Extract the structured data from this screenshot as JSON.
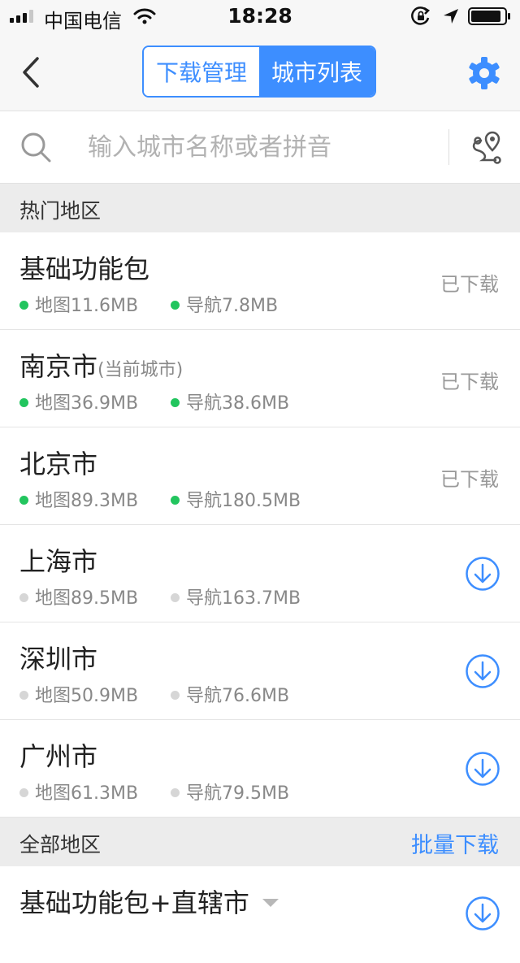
{
  "status_bar": {
    "carrier": "中国电信",
    "time": "18:28"
  },
  "nav": {
    "tab_download": "下载管理",
    "tab_cities": "城市列表"
  },
  "search": {
    "placeholder": "输入城市名称或者拼音",
    "value": ""
  },
  "sections": {
    "hot": "热门地区",
    "all": "全部地区",
    "batch_download": "批量下载"
  },
  "hot_items": [
    {
      "name": "基础功能包",
      "note": "",
      "map": "地图11.6MB",
      "nav": "导航7.8MB",
      "status": "已下载"
    },
    {
      "name": "南京市",
      "note": "(当前城市)",
      "map": "地图36.9MB",
      "nav": "导航38.6MB",
      "status": "已下载"
    },
    {
      "name": "北京市",
      "note": "",
      "map": "地图89.3MB",
      "nav": "导航180.5MB",
      "status": "已下载"
    },
    {
      "name": "上海市",
      "note": "",
      "map": "地图89.5MB",
      "nav": "导航163.7MB",
      "status": ""
    },
    {
      "name": "深圳市",
      "note": "",
      "map": "地图50.9MB",
      "nav": "导航76.6MB",
      "status": ""
    },
    {
      "name": "广州市",
      "note": "",
      "map": "地图61.3MB",
      "nav": "导航79.5MB",
      "status": ""
    }
  ],
  "all_items": [
    {
      "name": "基础功能包+直辖市"
    }
  ],
  "colors": {
    "accent": "#3d8eff",
    "downloaded_dot": "#22c55e",
    "pending_dot": "#d6d6d6"
  },
  "icons": [
    "signal-icon",
    "wifi-icon",
    "rotation-lock-icon",
    "location-arrow-icon",
    "battery-icon",
    "back-chevron-icon",
    "gear-icon",
    "search-icon",
    "route-pin-icon",
    "download-circle-icon",
    "dropdown-caret-icon"
  ]
}
